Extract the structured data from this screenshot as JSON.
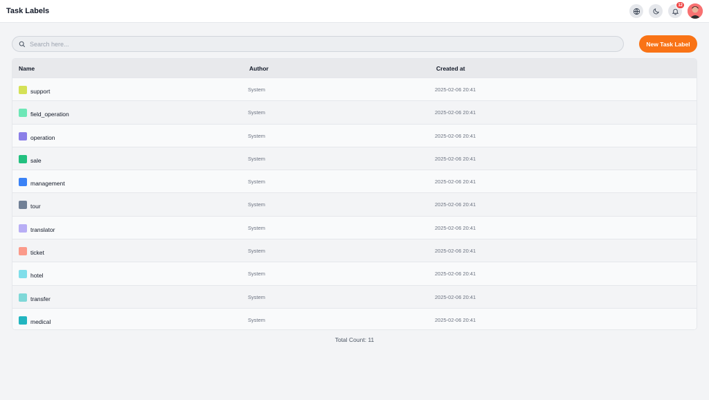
{
  "header": {
    "title": "Task Labels",
    "notification_count": "12"
  },
  "search": {
    "placeholder": "Search here..."
  },
  "toolbar": {
    "new_label": "New Task Label"
  },
  "table": {
    "columns": {
      "name": "Name",
      "author": "Author",
      "created": "Created at"
    },
    "rows": [
      {
        "name": "support",
        "author": "System",
        "created": "2025-02-06 20:41",
        "color": "#d4e157"
      },
      {
        "name": "field_operation",
        "author": "System",
        "created": "2025-02-06 20:41",
        "color": "#6ee7b7"
      },
      {
        "name": "operation",
        "author": "System",
        "created": "2025-02-06 20:41",
        "color": "#8b7fe8"
      },
      {
        "name": "sale",
        "author": "System",
        "created": "2025-02-06 20:41",
        "color": "#22c07f"
      },
      {
        "name": "management",
        "author": "System",
        "created": "2025-02-06 20:41",
        "color": "#3b82f6"
      },
      {
        "name": "tour",
        "author": "System",
        "created": "2025-02-06 20:41",
        "color": "#718096"
      },
      {
        "name": "translator",
        "author": "System",
        "created": "2025-02-06 20:41",
        "color": "#b8aef5"
      },
      {
        "name": "ticket",
        "author": "System",
        "created": "2025-02-06 20:41",
        "color": "#fb9a8a"
      },
      {
        "name": "hotel",
        "author": "System",
        "created": "2025-02-06 20:41",
        "color": "#80deea"
      },
      {
        "name": "transfer",
        "author": "System",
        "created": "2025-02-06 20:41",
        "color": "#7fd8d8"
      },
      {
        "name": "medical",
        "author": "System",
        "created": "2025-02-06 20:41",
        "color": "#22b5c0"
      }
    ]
  },
  "footer": {
    "total": "Total Count: 11"
  },
  "colors": {
    "accent": "#f97316",
    "badge": "#ef4444"
  },
  "icons": [
    "globe-icon",
    "moon-icon",
    "bell-icon",
    "search-icon"
  ]
}
